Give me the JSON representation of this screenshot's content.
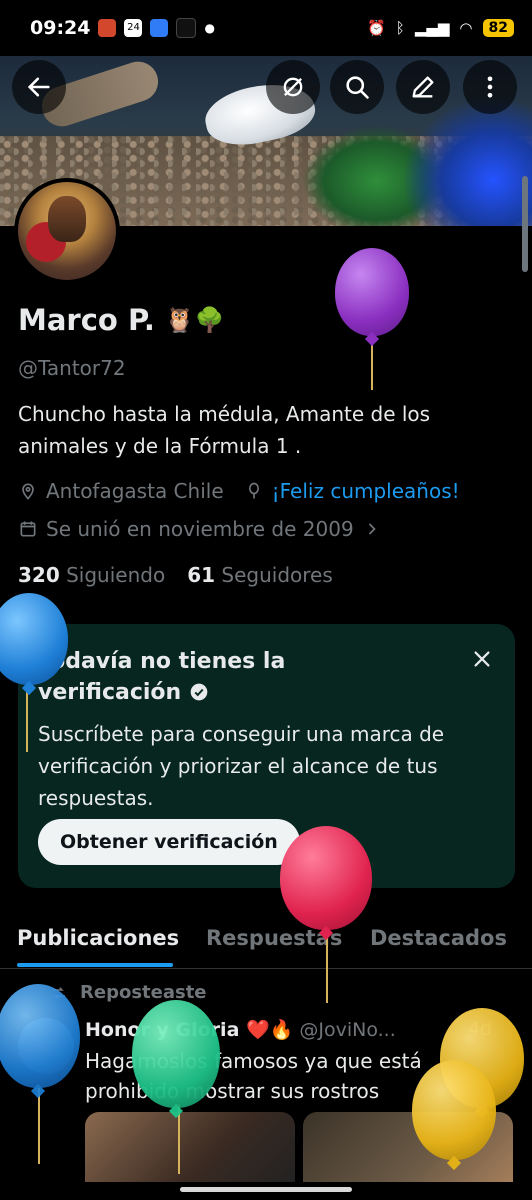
{
  "status_bar": {
    "time": "09:24",
    "calendar_day": "24",
    "battery": "82"
  },
  "profile": {
    "name": "Marco P.",
    "name_emojis": "🦉🌳",
    "handle": "@Tantor72",
    "bio": "Chuncho hasta la médula, Amante de los animales y de la Fórmula 1 .",
    "location": "Antofagasta Chile",
    "birthday_link": "¡Feliz cumpleaños!",
    "joined": "Se unió en noviembre de 2009",
    "following_count": "320",
    "following_label": "Siguiendo",
    "followers_count": "61",
    "followers_label": "Seguidores"
  },
  "verification_card": {
    "title": "Todavía no tienes la verificación",
    "body": "Suscríbete para conseguir una marca de verificación y priorizar el alcance de tus respuestas.",
    "button": "Obtener verificación"
  },
  "tabs": [
    {
      "label": "Publicaciones",
      "active": true
    },
    {
      "label": "Respuestas",
      "active": false
    },
    {
      "label": "Destacados",
      "active": false
    }
  ],
  "post": {
    "repost_label": "Reposteaste",
    "author_name": "Honor y Gloria ❤️🔥",
    "author_handle": "@JoviNo...",
    "time": "4d",
    "text": "Hagamoslos famosos ya que está prohibido mostrar sus rostros"
  },
  "colors": {
    "accent": "#1d9bf0",
    "card_bg": "#06261f",
    "muted": "#71767b"
  },
  "icons": [
    "back-arrow-icon",
    "translate-icon",
    "search-icon",
    "edit-icon",
    "more-vertical-icon",
    "location-pin-icon",
    "balloon-icon",
    "calendar-icon",
    "chevron-right-icon",
    "verified-badge-icon",
    "close-icon",
    "repost-icon"
  ]
}
